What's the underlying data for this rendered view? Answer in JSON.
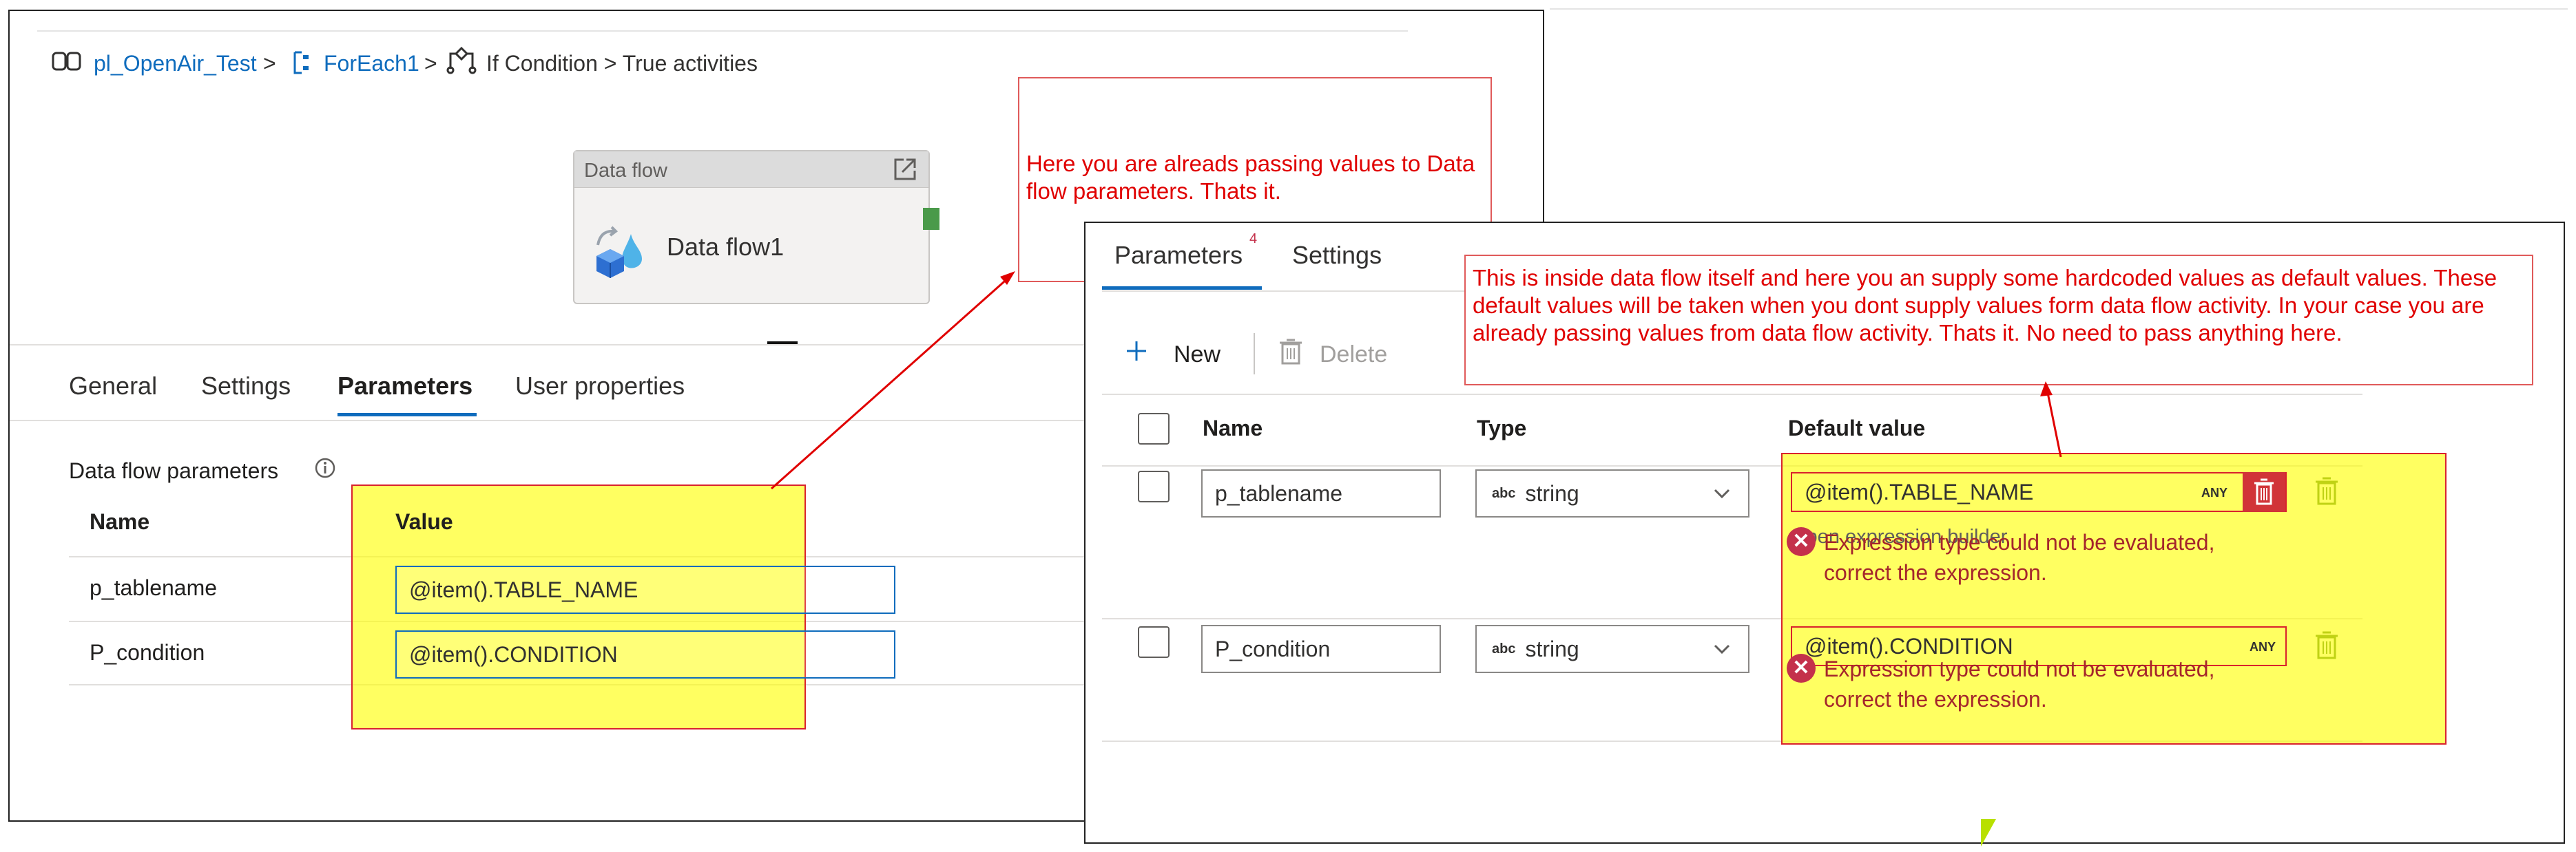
{
  "breadcrumb": {
    "pipeline": "pl_OpenAir_Test",
    "sep1": ">",
    "foreach": "ForEach1",
    "sep2": ">",
    "ifcondition": "If Condition > True activities"
  },
  "activity": {
    "type": "Data flow",
    "name": "Data flow1"
  },
  "tabs": [
    {
      "label": "General"
    },
    {
      "label": "Settings"
    },
    {
      "label": "Parameters"
    },
    {
      "label": "User properties"
    }
  ],
  "left_params": {
    "section_title": "Data flow parameters",
    "col_name": "Name",
    "col_value": "Value",
    "rows": [
      {
        "name": "p_tablename",
        "value": "@item().TABLE_NAME"
      },
      {
        "name": "P_condition",
        "value": "@item().CONDITION"
      }
    ]
  },
  "notes": {
    "left": "Here you are alreads passing values to Data flow parameters. Thats it.",
    "right": "This is inside data flow itself and here you  an supply some hardcoded values as default values. These default values will be taken when you dont supply values form data flow activity. In your case you are already passing values from data flow activity. Thats it. No need to pass anything here."
  },
  "right_panel": {
    "tab_parameters": "Parameters",
    "tab_parameters_badge": "4",
    "tab_settings": "Settings",
    "new_label": "New",
    "delete_label": "Delete",
    "col_name": "Name",
    "col_type": "Type",
    "col_default": "Default value",
    "rows": [
      {
        "name": "p_tablename",
        "type_badge": "abc",
        "type": "string",
        "default": "@item().TABLE_NAME",
        "any": "ANY",
        "hint": "Open expression builder",
        "error1": "Expression type could not be evaluated,",
        "error2": "correct the expression."
      },
      {
        "name": "P_condition",
        "type_badge": "abc",
        "type": "string",
        "default": "@item().CONDITION",
        "any": "ANY",
        "error1": "Expression type could not be evaluated,",
        "error2": "correct the expression."
      }
    ]
  },
  "colors": {
    "accent": "#0f6cbd",
    "highlight": "#ffff00",
    "annotation": "#e00000",
    "error": "#a4262c"
  }
}
